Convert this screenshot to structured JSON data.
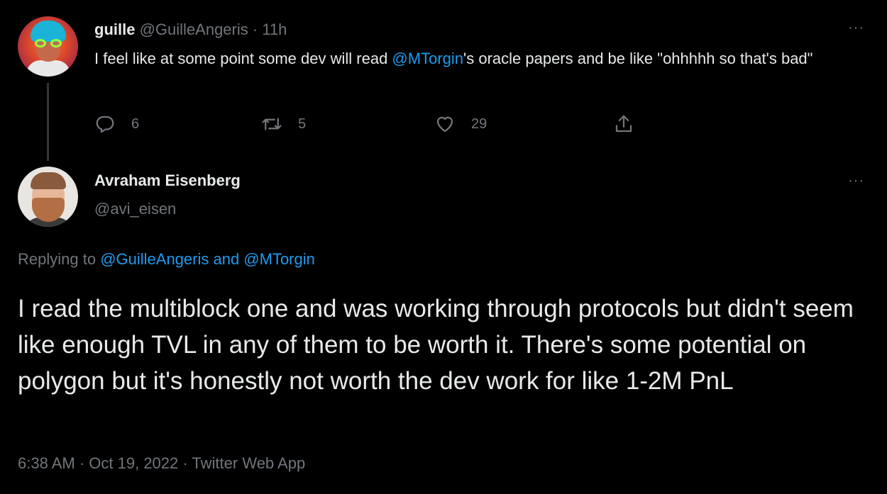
{
  "original_tweet": {
    "author_name": "guille",
    "author_handle": "@GuilleAngeris",
    "separator": "·",
    "time": "11h",
    "text_before_mention": "I feel like at some point some dev will read ",
    "mention": "@MTorgin",
    "text_after_mention": "'s oracle papers and be like \"ohhhhh so that's bad\"",
    "actions": {
      "reply_count": "6",
      "retweet_count": "5",
      "like_count": "29"
    },
    "more_label": "···"
  },
  "reply_tweet": {
    "author_name": "Avraham Eisenberg",
    "author_handle": "@avi_eisen",
    "more_label": "···",
    "replying_prefix": "Replying to ",
    "replying_to": "@GuilleAngeris and @MTorgin",
    "text": "I read the multiblock one and was working through protocols but didn't seem like enough TVL in any of them to be worth it. There's some potential on polygon but it's honestly not worth the dev work for like 1-2M PnL",
    "time": "6:38 AM",
    "date": "Oct 19, 2022",
    "source": "Twitter Web App",
    "meta_separator": " · "
  },
  "colors": {
    "background": "#000000",
    "text": "#e7e9ea",
    "muted": "#71767b",
    "link": "#1d9bf0"
  },
  "icons": [
    "reply-icon",
    "retweet-icon",
    "like-icon",
    "share-icon",
    "more-icon"
  ]
}
